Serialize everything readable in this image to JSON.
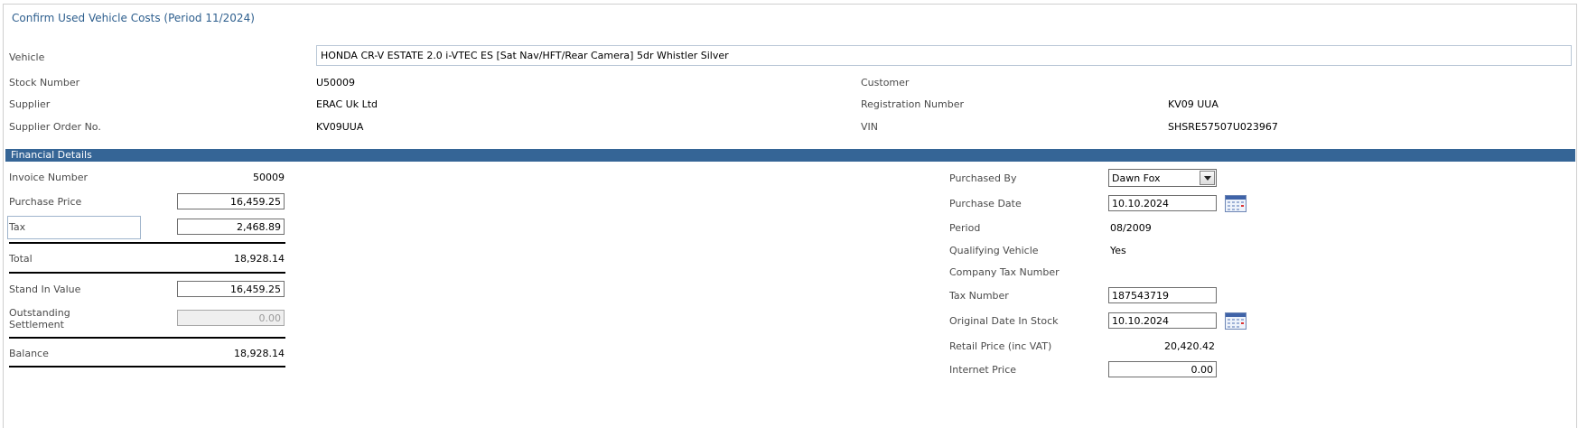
{
  "page": {
    "title": "Confirm Used Vehicle Costs (Period  11/2024)"
  },
  "vehicle": {
    "label": "Vehicle",
    "value": "HONDA CR-V ESTATE 2.0 i-VTEC ES [Sat Nav/HFT/Rear Camera] 5dr Whistler Silver"
  },
  "info": {
    "stock_number": {
      "label": "Stock Number",
      "value": "U50009"
    },
    "supplier": {
      "label": "Supplier",
      "value": "ERAC Uk Ltd"
    },
    "supplier_order": {
      "label": "Supplier Order No.",
      "value": "KV09UUA"
    },
    "customer": {
      "label": "Customer",
      "value": ""
    },
    "registration": {
      "label": "Registration Number",
      "value": "KV09 UUA"
    },
    "vin": {
      "label": "VIN",
      "value": "SHSRE57507U023967"
    }
  },
  "financial": {
    "header": "Financial Details",
    "invoice_number": {
      "label": "Invoice Number",
      "value": "50009"
    },
    "purchase_price": {
      "label": "Purchase Price",
      "value": "16,459.25"
    },
    "tax": {
      "label": "Tax",
      "value": "2,468.89"
    },
    "total": {
      "label": "Total",
      "value": "18,928.14"
    },
    "stand_in_value": {
      "label": "Stand In Value",
      "value": "16,459.25"
    },
    "outstanding_settlement": {
      "label_line1": "Outstanding",
      "label_line2": "Settlement",
      "value": "0.00"
    },
    "balance": {
      "label": "Balance",
      "value": "18,928.14"
    }
  },
  "purchase": {
    "purchased_by": {
      "label": "Purchased By",
      "value": "Dawn Fox"
    },
    "purchase_date": {
      "label": "Purchase Date",
      "value": "10.10.2024"
    },
    "period": {
      "label": "Period",
      "value": "08/2009"
    },
    "qualifying_vehicle": {
      "label": "Qualifying Vehicle",
      "value": "Yes"
    },
    "company_tax_number": {
      "label": "Company Tax Number",
      "value": ""
    },
    "tax_number": {
      "label": "Tax Number",
      "value": "187543719"
    },
    "original_date_in_stock": {
      "label": "Original Date In Stock",
      "value": "10.10.2024"
    },
    "retail_price": {
      "label": "Retail Price (inc VAT)",
      "value": "20,420.42"
    },
    "internet_price": {
      "label": "Internet Price",
      "value": "0.00"
    }
  }
}
